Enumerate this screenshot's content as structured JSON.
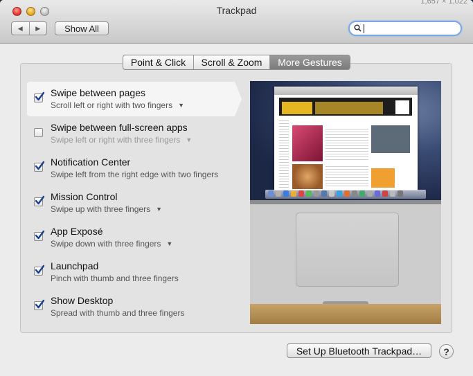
{
  "window": {
    "title": "Trackpad",
    "corner_text": "1,657 × 1,022",
    "show_all_label": "Show All",
    "back_icon": "◀",
    "forward_icon": "▶"
  },
  "search": {
    "value": "",
    "placeholder": ""
  },
  "tabs": [
    {
      "label": "Point & Click",
      "active": false
    },
    {
      "label": "Scroll & Zoom",
      "active": false
    },
    {
      "label": "More Gestures",
      "active": true
    }
  ],
  "gestures": [
    {
      "title": "Swipe between pages",
      "subtitle": "Scroll left or right with two fingers",
      "checked": true,
      "has_menu": true,
      "selected": true
    },
    {
      "title": "Swipe between full-screen apps",
      "subtitle": "Swipe left or right with three fingers",
      "checked": false,
      "has_menu": true
    },
    {
      "title": "Notification Center",
      "subtitle": "Swipe left from the right edge with two fingers",
      "checked": true,
      "has_menu": false
    },
    {
      "title": "Mission Control",
      "subtitle": "Swipe up with three fingers",
      "checked": true,
      "has_menu": true
    },
    {
      "title": "App Exposé",
      "subtitle": "Swipe down with three fingers",
      "checked": true,
      "has_menu": true
    },
    {
      "title": "Launchpad",
      "subtitle": "Pinch with thumb and three fingers",
      "checked": true,
      "has_menu": false
    },
    {
      "title": "Show Desktop",
      "subtitle": "Spread with thumb and three fingers",
      "checked": true,
      "has_menu": false
    }
  ],
  "menu_arrow": "▼",
  "footer": {
    "bluetooth_button": "Set Up Bluetooth Trackpad…",
    "help_label": "?"
  },
  "colors": {
    "checkmark": "#1a3f8a",
    "search_focus": "#7ea7e6",
    "active_tab": "#8a8a8a"
  }
}
